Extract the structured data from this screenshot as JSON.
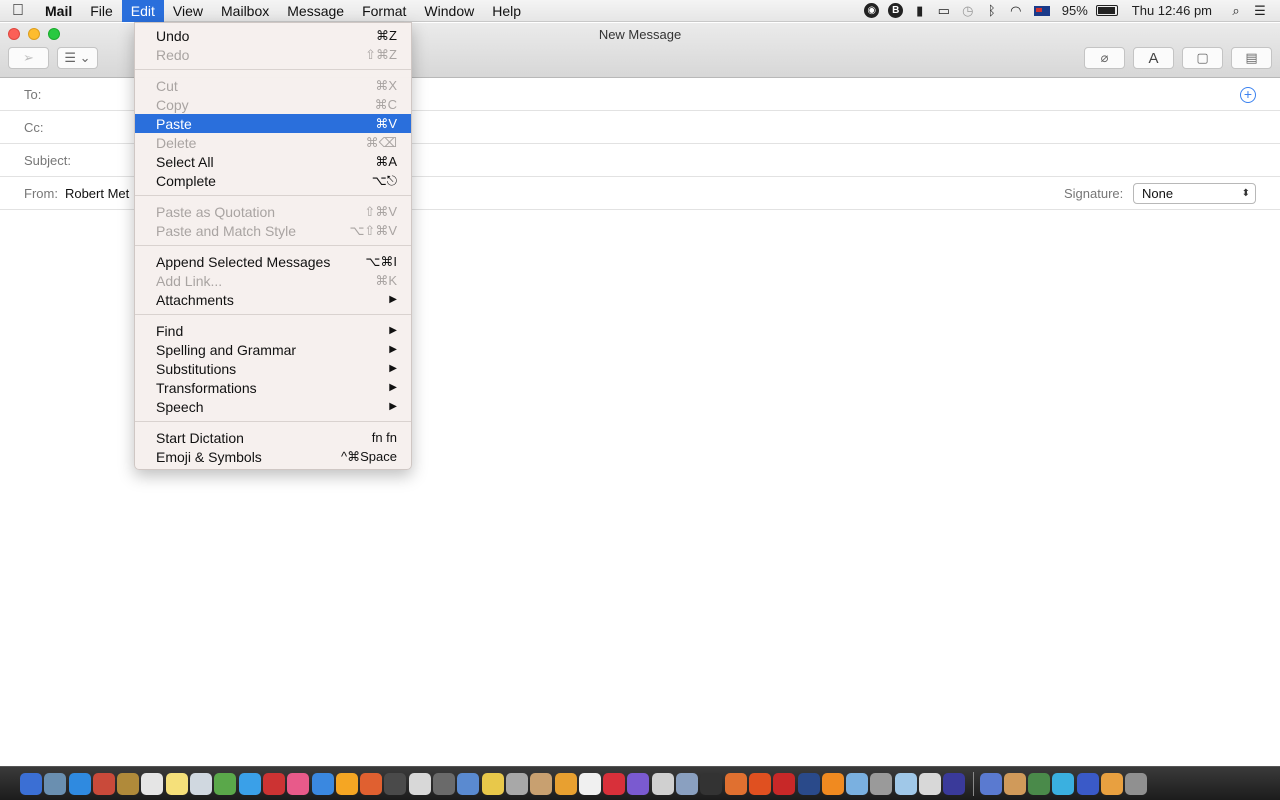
{
  "menubar": {
    "app_name": "Mail",
    "menus": [
      "File",
      "Edit",
      "View",
      "Mailbox",
      "Message",
      "Format",
      "Window",
      "Help"
    ],
    "active_menu": "Edit",
    "battery": "95%",
    "clock": "Thu 12:46 pm"
  },
  "window": {
    "title": "New Message",
    "fields": {
      "to_label": "To:",
      "cc_label": "Cc:",
      "subject_label": "Subject:",
      "from_label": "From:",
      "from_value": "Robert Met",
      "signature_label": "Signature:",
      "signature_value": "None"
    },
    "toolbar": {
      "font_label": "A"
    }
  },
  "edit_menu": {
    "groups": [
      [
        {
          "label": "Undo",
          "shortcut": "⌘Z",
          "enabled": true
        },
        {
          "label": "Redo",
          "shortcut": "⇧⌘Z",
          "enabled": false
        }
      ],
      [
        {
          "label": "Cut",
          "shortcut": "⌘X",
          "enabled": false
        },
        {
          "label": "Copy",
          "shortcut": "⌘C",
          "enabled": false
        },
        {
          "label": "Paste",
          "shortcut": "⌘V",
          "enabled": true,
          "highlighted": true
        },
        {
          "label": "Delete",
          "shortcut": "⌘⌫",
          "enabled": false
        },
        {
          "label": "Select All",
          "shortcut": "⌘A",
          "enabled": true
        },
        {
          "label": "Complete",
          "shortcut": "⌥⎋",
          "enabled": true
        }
      ],
      [
        {
          "label": "Paste as Quotation",
          "shortcut": "⇧⌘V",
          "enabled": false
        },
        {
          "label": "Paste and Match Style",
          "shortcut": "⌥⇧⌘V",
          "enabled": false
        }
      ],
      [
        {
          "label": "Append Selected Messages",
          "shortcut": "⌥⌘I",
          "enabled": true
        },
        {
          "label": "Add Link...",
          "shortcut": "⌘K",
          "enabled": false
        },
        {
          "label": "Attachments",
          "submenu": true,
          "enabled": true
        }
      ],
      [
        {
          "label": "Find",
          "submenu": true,
          "enabled": true
        },
        {
          "label": "Spelling and Grammar",
          "submenu": true,
          "enabled": true
        },
        {
          "label": "Substitutions",
          "submenu": true,
          "enabled": true
        },
        {
          "label": "Transformations",
          "submenu": true,
          "enabled": true
        },
        {
          "label": "Speech",
          "submenu": true,
          "enabled": true
        }
      ],
      [
        {
          "label": "Start Dictation",
          "shortcut": "fn fn",
          "enabled": true
        },
        {
          "label": "Emoji & Symbols",
          "shortcut": "^⌘Space",
          "enabled": true
        }
      ]
    ]
  },
  "dock": {
    "colors": [
      "#3b6fd4",
      "#6a8fb0",
      "#2f8ae0",
      "#c94a3a",
      "#b08a3a",
      "#e5e5e5",
      "#f5e07a",
      "#d0d8e0",
      "#5aa84a",
      "#3aa0e8",
      "#c33",
      "#e85a8a",
      "#3a88e0",
      "#f5a623",
      "#e06030",
      "#4a4a4a",
      "#d8d8d8",
      "#6a6a6a",
      "#5a8ad0",
      "#e8c84a",
      "#a8a8a8",
      "#c8a070",
      "#e8a030",
      "#f0f0f0",
      "#d8303a",
      "#7a5ad0",
      "#d0d0d0",
      "#8aa0c0",
      "#333",
      "#e07030",
      "#e05020",
      "#c82828",
      "#2a4a8a",
      "#f08a20",
      "#7ab0e0",
      "#9a9a9a",
      "#a0c8e8",
      "#d8d8d8",
      "#3a3a9a",
      "#5a7ad0",
      "#d09a5a",
      "#4a8a4a",
      "#3ab0e0",
      "#3a5ac8",
      "#e8a040",
      "#909090"
    ]
  }
}
